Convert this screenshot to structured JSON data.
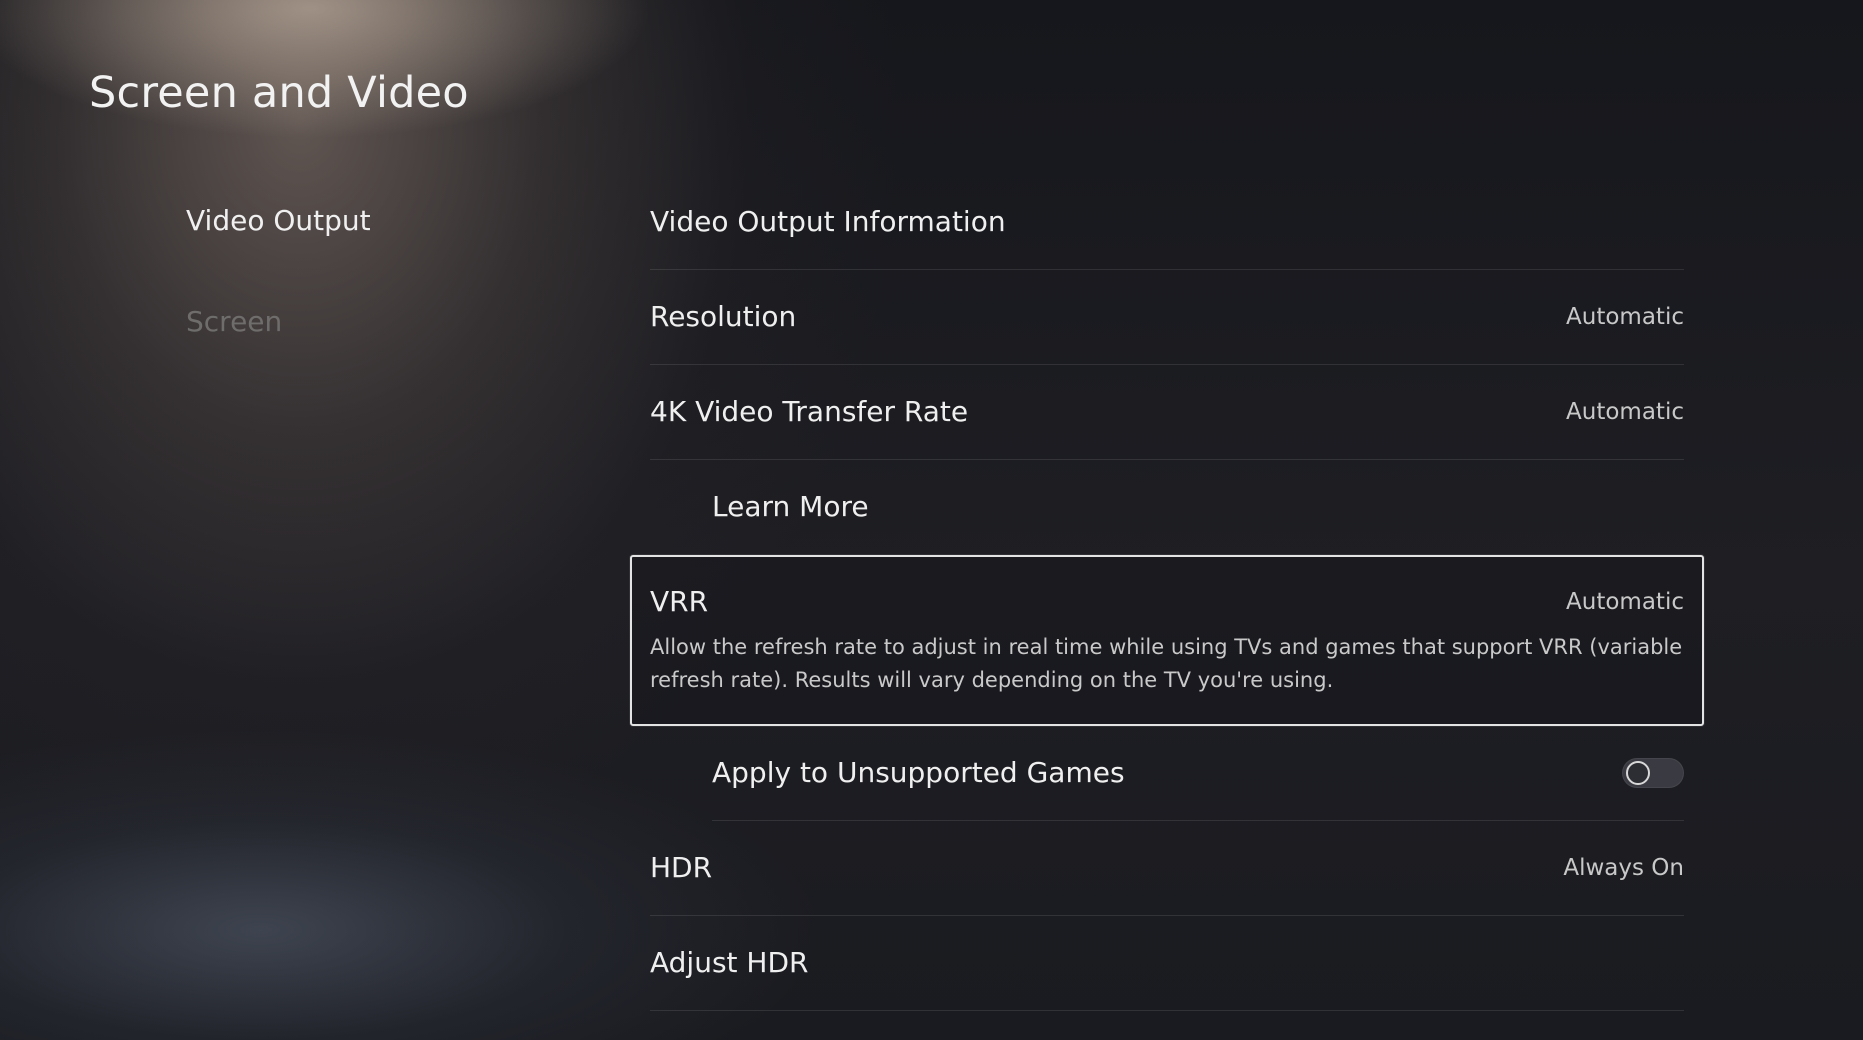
{
  "page": {
    "title": "Screen and Video"
  },
  "sidebar": {
    "items": [
      {
        "label": "Video Output",
        "selected": true
      },
      {
        "label": "Screen",
        "selected": false
      }
    ]
  },
  "settings": {
    "video_output_information": {
      "label": "Video Output Information"
    },
    "resolution": {
      "label": "Resolution",
      "value": "Automatic"
    },
    "transfer_rate": {
      "label": "4K Video Transfer Rate",
      "value": "Automatic"
    },
    "learn_more": {
      "label": "Learn More"
    },
    "vrr": {
      "label": "VRR",
      "value": "Automatic",
      "description": "Allow the refresh rate to adjust in real time while using TVs and games that support VRR (variable refresh rate). Results will vary depending on the TV you're using."
    },
    "apply_unsupported": {
      "label": "Apply to Unsupported Games",
      "enabled": false
    },
    "hdr": {
      "label": "HDR",
      "value": "Always On"
    },
    "adjust_hdr": {
      "label": "Adjust HDR"
    }
  }
}
